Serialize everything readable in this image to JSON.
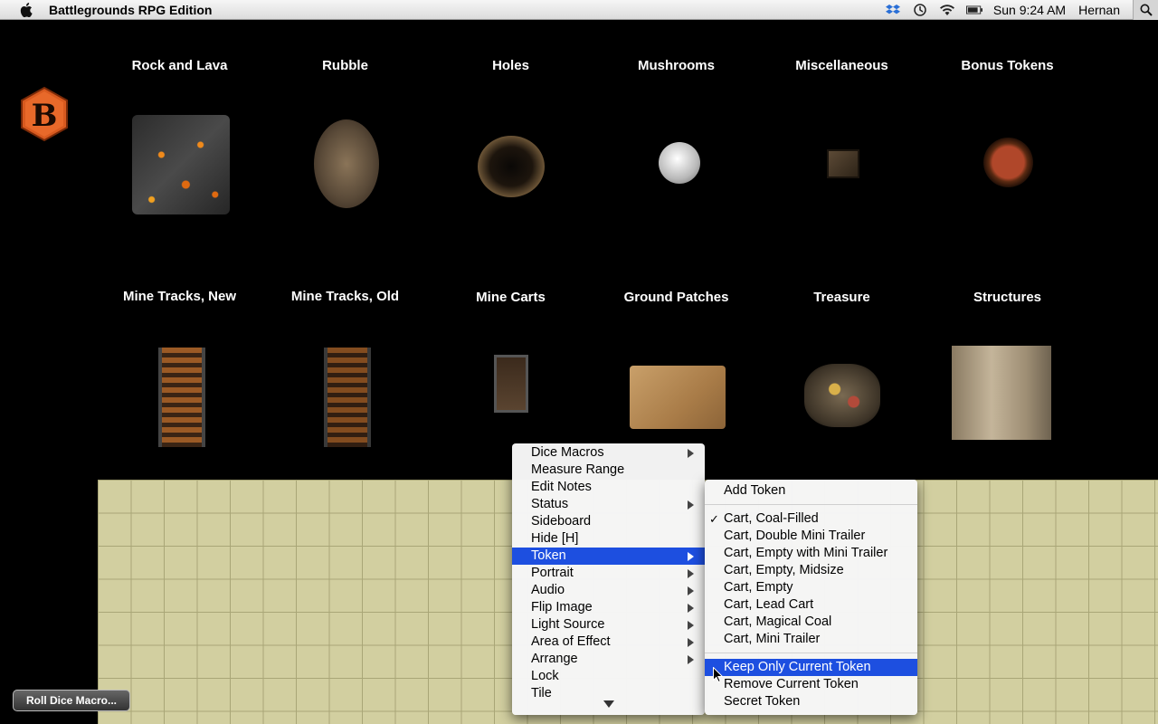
{
  "menubar": {
    "app_name": "Battlegrounds RPG Edition",
    "clock": "Sun 9:24 AM",
    "user": "Hernan"
  },
  "logo": {
    "letter": "B",
    "color": "#e25a1c"
  },
  "categories": [
    {
      "label": "Rock and Lava"
    },
    {
      "label": "Rubble"
    },
    {
      "label": "Holes"
    },
    {
      "label": "Mushrooms"
    },
    {
      "label": "Miscellaneous"
    },
    {
      "label": "Bonus Tokens"
    },
    {
      "label": "Mine Tracks, New"
    },
    {
      "label": "Mine Tracks, Old"
    },
    {
      "label": "Mine Carts"
    },
    {
      "label": "Ground Patches"
    },
    {
      "label": "Treasure"
    },
    {
      "label": "Structures"
    }
  ],
  "roll_button": "Roll Dice Macro...",
  "context_menu": {
    "items": [
      {
        "label": "Dice Macros",
        "submenu": true
      },
      {
        "label": "Measure Range",
        "submenu": false
      },
      {
        "label": "Edit Notes",
        "submenu": false
      },
      {
        "label": "Status",
        "submenu": true
      },
      {
        "label": "Sideboard",
        "submenu": false
      },
      {
        "label": "Hide [H]",
        "submenu": false
      },
      {
        "label": "Token",
        "submenu": true,
        "selected": true
      },
      {
        "label": "Portrait",
        "submenu": true
      },
      {
        "label": "Audio",
        "submenu": true
      },
      {
        "label": "Flip Image",
        "submenu": true
      },
      {
        "label": "Light Source",
        "submenu": true
      },
      {
        "label": "Area of Effect",
        "submenu": true
      },
      {
        "label": "Arrange",
        "submenu": true
      },
      {
        "label": "Lock",
        "submenu": false
      },
      {
        "label": "Tile",
        "submenu": false
      }
    ]
  },
  "token_submenu": {
    "add": "Add Token",
    "tokens": [
      {
        "label": "Cart, Coal-Filled",
        "checked": true
      },
      {
        "label": "Cart, Double Mini Trailer",
        "checked": false
      },
      {
        "label": "Cart, Empty with Mini Trailer",
        "checked": false
      },
      {
        "label": "Cart, Empty, Midsize",
        "checked": false
      },
      {
        "label": "Cart, Empty",
        "checked": false
      },
      {
        "label": "Cart, Lead Cart",
        "checked": false
      },
      {
        "label": "Cart, Magical Coal",
        "checked": false
      },
      {
        "label": "Cart, Mini Trailer",
        "checked": false
      }
    ],
    "actions": [
      {
        "label": "Keep Only Current Token",
        "selected": true
      },
      {
        "label": "Remove Current Token",
        "selected": false
      },
      {
        "label": "Secret Token",
        "selected": false
      }
    ],
    "check_mark": "✓"
  },
  "colors": {
    "menu_highlight": "#1d4fe0",
    "board": "#d2cfa0"
  }
}
